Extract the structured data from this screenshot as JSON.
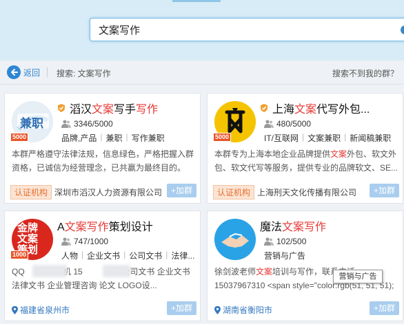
{
  "search": {
    "value": "文案写作"
  },
  "nav": {
    "back_label": "返回",
    "search_crumb": "搜索: 文案写作",
    "not_found_link": "搜索不到我的群？"
  },
  "cards": [
    {
      "title_pre": "滔汉",
      "title_hl1": "文案",
      "title_mid": "写手",
      "title_hl2": "写作",
      "title_post": "",
      "verified": true,
      "avatar_text": "兼职",
      "member_badge": "5000",
      "members": "3346/5000",
      "tags": [
        "品牌,产品",
        "兼职",
        "写作兼职"
      ],
      "desc_pre": "本群严格遵守法律法规，信息绿色，严格把握入群资格，已诚信为经营理念，已共赢为最终目的。",
      "desc_hl": "",
      "desc_post": "",
      "cert": "认证机构",
      "org": "深圳市滔汉人力资源有限公司",
      "location": "",
      "join_label": "+加群"
    },
    {
      "title_pre": "上海",
      "title_hl1": "文案",
      "title_mid": "代写外包...",
      "title_hl2": "",
      "title_post": "",
      "verified": true,
      "avatar_text": "",
      "member_badge": "5000",
      "members": "480/5000",
      "tags": [
        "IT/互联网",
        "文案兼职",
        "新闻稿兼职"
      ],
      "desc_pre": "本群专为上海本地企业品牌提供",
      "desc_hl": "文案",
      "desc_post": "外包、软文外包、软文代写等服务，提供专业的品牌软文、SE...",
      "cert": "认证机构",
      "org": "上海刑天文化传播有限公司",
      "location": "",
      "join_label": "+加群"
    },
    {
      "title_pre": "A",
      "title_hl1": "文案",
      "title_mid": "",
      "title_hl2": "写作",
      "title_post": "策划设计",
      "verified": false,
      "avatar_text": "金牌文案策划",
      "member_badge": "1000",
      "members": "747/1000",
      "tags": [
        "人物",
        "企业文书",
        "公司文书",
        "法律..."
      ],
      "desc_pre": "QQ          5 手机 15          729 公司文书 企业文书 法律文书 企业管理咨询 论文 LOGO设...",
      "desc_hl": "",
      "desc_post": "",
      "cert": "",
      "org": "",
      "location": "福建省泉州市",
      "join_label": "+加群"
    },
    {
      "title_pre": "魔法",
      "title_hl1": "文案",
      "title_mid": "",
      "title_hl2": "写作",
      "title_post": "",
      "verified": false,
      "avatar_text": "",
      "member_badge": "",
      "members": "102/500",
      "tags": [
        "营销与广告"
      ],
      "desc_pre": "徐剑波老师",
      "desc_hl": "文案",
      "desc_post": "培训与写作，联系电话15037967310 <span style=\"color:rgb(51, 51, 51); font-...",
      "cert": "",
      "org": "",
      "location": "湖南省衡阳市",
      "join_label": "+加群"
    }
  ],
  "tooltip": "营销与广告",
  "colors": {
    "accent": "#2f87d3",
    "highlight": "#e53935",
    "join_button": "#a9cdee",
    "cert_badge": "#e8702f"
  }
}
